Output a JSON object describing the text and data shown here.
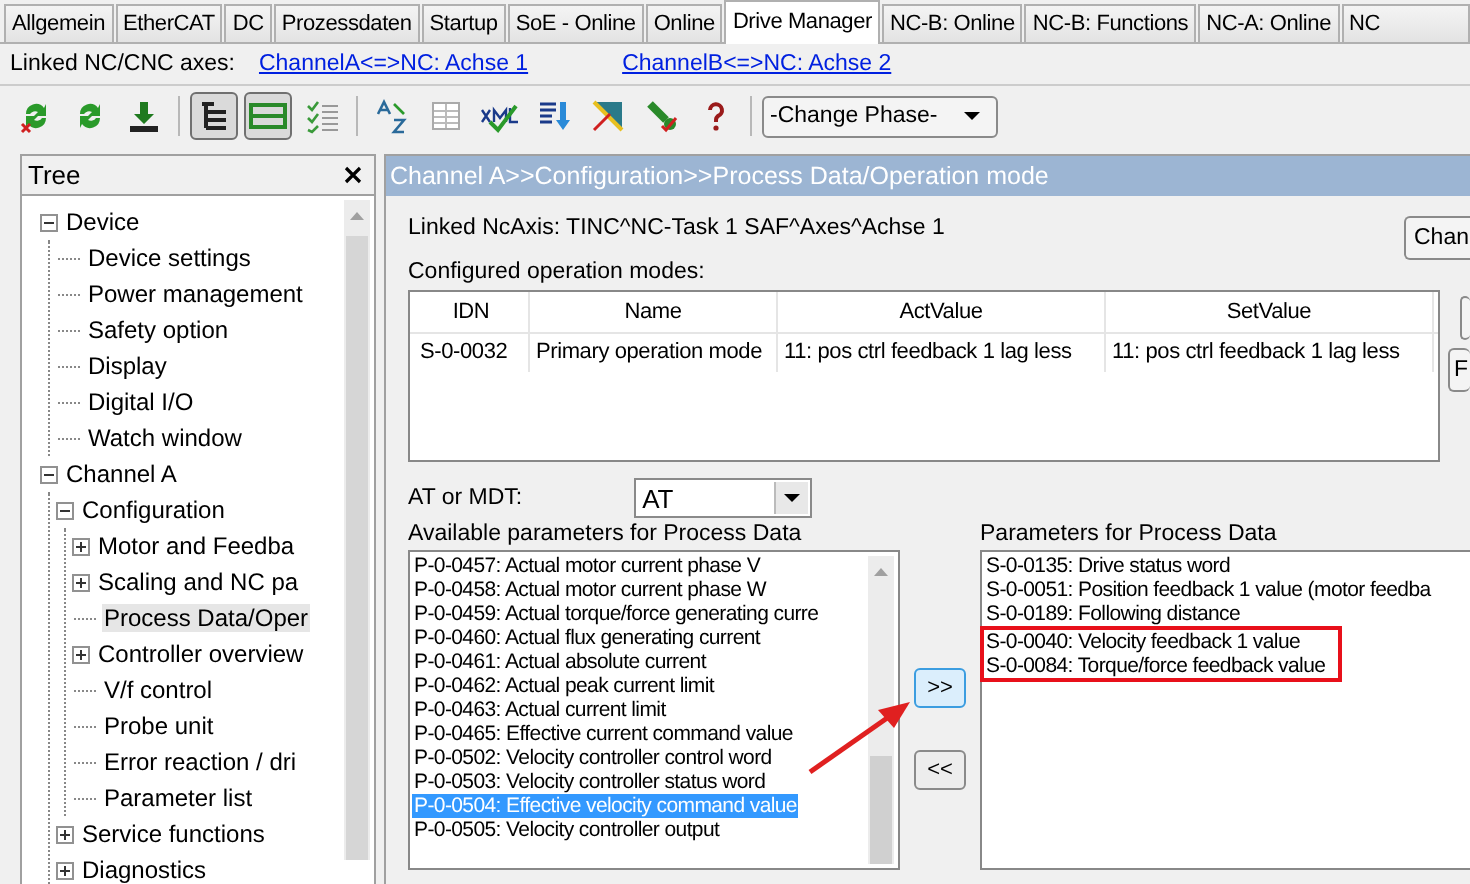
{
  "tabs": [
    {
      "label": "Allgemein",
      "selected": false
    },
    {
      "label": "EtherCAT",
      "selected": false
    },
    {
      "label": "DC",
      "selected": false
    },
    {
      "label": "Prozessdaten",
      "selected": false
    },
    {
      "label": "Startup",
      "selected": false
    },
    {
      "label": "SoE - Online",
      "selected": false
    },
    {
      "label": "Online",
      "selected": false
    },
    {
      "label": "Drive Manager",
      "selected": true
    },
    {
      "label": "NC-B: Online",
      "selected": false
    },
    {
      "label": "NC-B: Functions",
      "selected": false
    },
    {
      "label": "NC-A: Online",
      "selected": false
    },
    {
      "label": "NC",
      "selected": false
    }
  ],
  "linked_axes": {
    "label": "Linked NC/CNC axes:",
    "links": [
      "ChannelA<=>NC: Achse 1",
      "ChannelB<=>NC: Achse 2"
    ]
  },
  "toolbar": {
    "groups": [
      [
        {
          "kind": "reload-x",
          "pressed": false
        },
        {
          "kind": "reload",
          "pressed": false
        },
        {
          "kind": "download",
          "pressed": false
        }
      ],
      [
        {
          "kind": "tree",
          "pressed": true
        },
        {
          "kind": "panel",
          "pressed": true
        },
        {
          "kind": "checklist",
          "pressed": false
        }
      ],
      [
        {
          "kind": "translate",
          "pressed": false
        },
        {
          "kind": "grid",
          "pressed": false
        },
        {
          "kind": "xml",
          "pressed": false
        },
        {
          "kind": "import",
          "pressed": false
        },
        {
          "kind": "chart",
          "pressed": false
        },
        {
          "kind": "wrench",
          "pressed": false
        },
        {
          "kind": "help",
          "pressed": false
        }
      ]
    ],
    "phase_dropdown": "-Change Phase-"
  },
  "tree": {
    "title": "Tree",
    "items": [
      {
        "label": "Device",
        "expanded": true,
        "selected": false,
        "children": [
          {
            "label": "Device settings",
            "selected": false
          },
          {
            "label": "Power management",
            "selected": false
          },
          {
            "label": "Safety option",
            "selected": false
          },
          {
            "label": "Display",
            "selected": false
          },
          {
            "label": "Digital I/O",
            "selected": false
          },
          {
            "label": "Watch window",
            "selected": false
          }
        ]
      },
      {
        "label": "Channel A",
        "expanded": true,
        "selected": false,
        "children": [
          {
            "label": "Configuration",
            "expanded": true,
            "selected": false,
            "children": [
              {
                "label": "Motor and Feedba",
                "expanded": false,
                "selected": false
              },
              {
                "label": "Scaling and NC pa",
                "expanded": false,
                "selected": false
              },
              {
                "label": "Process Data/Oper",
                "selected": true
              },
              {
                "label": "Controller overview",
                "expanded": false,
                "selected": false
              },
              {
                "label": "V/f control",
                "selected": false
              },
              {
                "label": "Probe unit",
                "selected": false
              },
              {
                "label": "Error reaction / dri",
                "selected": false
              },
              {
                "label": "Parameter list",
                "selected": false
              }
            ]
          },
          {
            "label": "Service functions",
            "expanded": false,
            "selected": false
          },
          {
            "label": "Diagnostics",
            "expanded": false,
            "selected": false
          }
        ]
      }
    ]
  },
  "panel": {
    "title": "Channel A>>Configuration>>Process Data/Operation mode",
    "linked_ncaxis": "Linked NcAxis: TINC^NC-Task 1 SAF^Axes^Achse 1",
    "side_buttons": [
      "Chan",
      "F"
    ],
    "modes_label": "Configured operation modes:",
    "table": {
      "columns": [
        "IDN",
        "Name",
        "ActValue",
        "SetValue"
      ],
      "rows": [
        [
          "S-0-0032",
          "Primary operation mode",
          "11: pos ctrl feedback 1 lag less",
          "11: pos ctrl feedback 1 lag less"
        ]
      ]
    },
    "at_mdt": {
      "label": "AT or MDT:",
      "value": "AT"
    },
    "available": {
      "label": "Available parameters for Process Data",
      "items": [
        {
          "text": "P-0-0457: Actual motor current phase V",
          "selected": false
        },
        {
          "text": "P-0-0458: Actual motor current phase W",
          "selected": false
        },
        {
          "text": "P-0-0459: Actual torque/force generating curre",
          "selected": false
        },
        {
          "text": "P-0-0460: Actual flux generating current",
          "selected": false
        },
        {
          "text": "P-0-0461: Actual absolute current",
          "selected": false
        },
        {
          "text": "P-0-0462: Actual peak current limit",
          "selected": false
        },
        {
          "text": "P-0-0463: Actual current limit",
          "selected": false
        },
        {
          "text": "P-0-0465: Effective current command value",
          "selected": false
        },
        {
          "text": "P-0-0502: Velocity controller control word",
          "selected": false
        },
        {
          "text": "P-0-0503: Velocity controller status word",
          "selected": false
        },
        {
          "text": "P-0-0504: Effective velocity command value",
          "selected": true
        },
        {
          "text": "P-0-0505: Velocity controller output",
          "selected": false
        }
      ]
    },
    "add_button": ">>",
    "remove_button": "<<",
    "process": {
      "label": "Parameters for Process Data",
      "items": [
        {
          "text": "S-0-0135: Drive status word",
          "highlighted": false
        },
        {
          "text": "S-0-0051: Position feedback 1 value (motor feedba",
          "highlighted": false
        },
        {
          "text": "S-0-0189: Following distance",
          "highlighted": false
        },
        {
          "text": "S-0-0040: Velocity feedback 1 value",
          "highlighted": true
        },
        {
          "text": "S-0-0084: Torque/force feedback value",
          "highlighted": true
        }
      ]
    }
  }
}
